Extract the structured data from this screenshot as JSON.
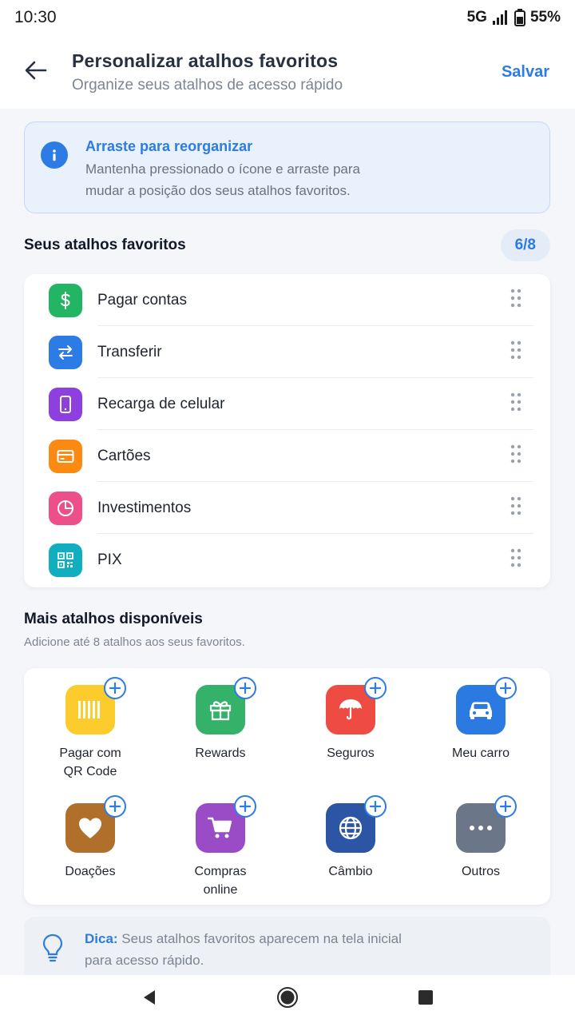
{
  "status_bar": {
    "time": "10:30",
    "network": "5G",
    "battery": "55%"
  },
  "header": {
    "title": "Personalizar atalhos favoritos",
    "subtitle": "Organize seus atalhos de acesso rápido",
    "save_label": "Salvar"
  },
  "info": {
    "title": "Arraste para reorganizar",
    "body_line1": "Mantenha pressionado o ícone e arraste para",
    "body_line2": "mudar a posição dos seus atalhos favoritos."
  },
  "favorites": {
    "title": "Seus atalhos favoritos",
    "count": "6/8",
    "items": [
      {
        "label": "Pagar contas",
        "icon": "dollar-icon",
        "color": "#22b564"
      },
      {
        "label": "Transferir",
        "icon": "transfer-icon",
        "color": "#2d7be5"
      },
      {
        "label": "Recarga de celular",
        "icon": "phone-icon",
        "color": "#8d3fe0"
      },
      {
        "label": "Cartões",
        "icon": "card-icon",
        "color": "#fb8a12"
      },
      {
        "label": "Investimentos",
        "icon": "pie-chart-icon",
        "color": "#ec4f8a"
      },
      {
        "label": "PIX",
        "icon": "qr-code-icon",
        "color": "#11aebf"
      }
    ]
  },
  "more": {
    "title": "Mais atalhos disponíveis",
    "subtitle": "Adicione até 8 atalhos aos seus favoritos.",
    "items": [
      {
        "label_line1": "Pagar com",
        "label_line2": "QR Code",
        "icon": "barcode-icon",
        "color": "#fbcc2c"
      },
      {
        "label_line1": "Rewards",
        "label_line2": "",
        "icon": "gift-icon",
        "color": "#35b26a"
      },
      {
        "label_line1": "Seguros",
        "label_line2": "",
        "icon": "umbrella-icon",
        "color": "#ee4b42"
      },
      {
        "label_line1": "Meu carro",
        "label_line2": "",
        "icon": "car-icon",
        "color": "#2a7ae2"
      },
      {
        "label_line1": "Doações",
        "label_line2": "",
        "icon": "heart-icon",
        "color": "#b0702c"
      },
      {
        "label_line1": "Compras",
        "label_line2": "online",
        "icon": "cart-icon",
        "color": "#9a4cc6"
      },
      {
        "label_line1": "Câmbio",
        "label_line2": "",
        "icon": "globe-icon",
        "color": "#2d55a5"
      },
      {
        "label_line1": "Outros",
        "label_line2": "",
        "icon": "more-icon",
        "color": "#6c7689"
      }
    ]
  },
  "tip": {
    "label": "Dica:",
    "line1": " Seus atalhos favoritos aparecem na tela inicial",
    "line2": "para acesso rápido."
  },
  "colors": {
    "accent": "#2d7be5",
    "background": "#f4f6fa"
  }
}
